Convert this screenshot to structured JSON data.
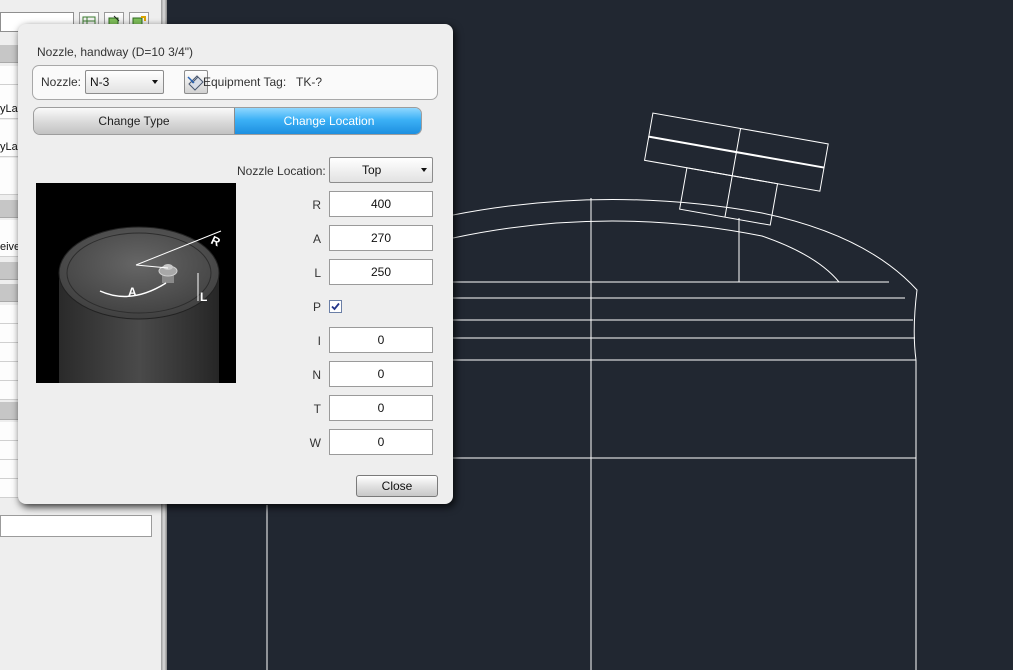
{
  "dialog": {
    "title": "Nozzle, handway (D=10 3/4\")",
    "nozzle_label": "Nozzle:",
    "nozzle_value": "N-3",
    "pick_icon": "pick-nozzle-icon",
    "equipment_tag_label": "Equipment Tag:",
    "equipment_tag_value": "TK-?",
    "tabs": [
      {
        "label": "Change Type",
        "active": false
      },
      {
        "label": "Change Location",
        "active": true
      }
    ],
    "location_label": "Nozzle Location:",
    "location_value": "Top",
    "preview": {
      "labels": [
        "R",
        "A",
        "L"
      ]
    },
    "fields": [
      {
        "key": "R",
        "value": "400"
      },
      {
        "key": "A",
        "value": "270"
      },
      {
        "key": "L",
        "value": "250"
      },
      {
        "key": "I",
        "value": "0"
      },
      {
        "key": "N",
        "value": "0"
      },
      {
        "key": "T",
        "value": "0"
      },
      {
        "key": "W",
        "value": "0"
      }
    ],
    "p_label": "P",
    "p_checked": true,
    "close_label": "Close"
  },
  "left_panel": {
    "rows": [
      "yLa",
      "yLa",
      "eive"
    ]
  },
  "colors": {
    "cad_background": "#212731",
    "cad_lines": "#ffffff",
    "active_tab": "#2f9fee"
  }
}
